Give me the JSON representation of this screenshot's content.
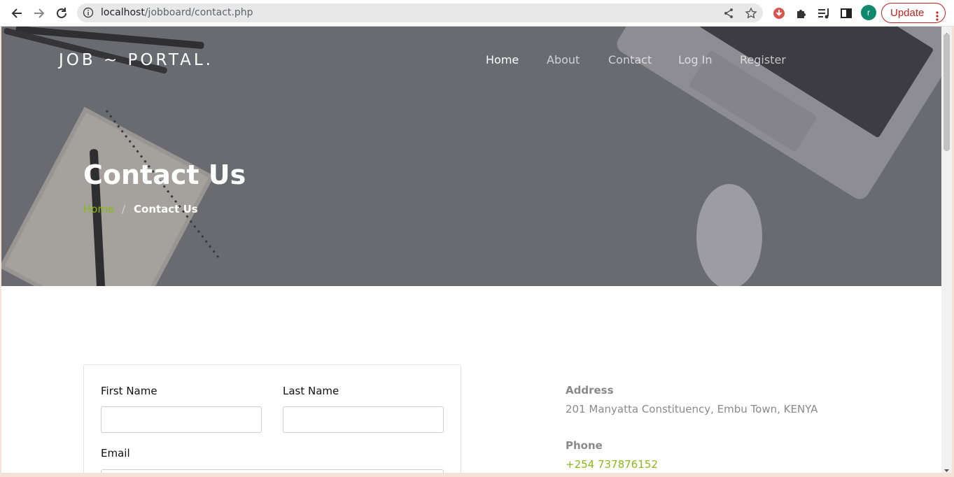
{
  "browser": {
    "url_host": "localhost",
    "url_path": "/jobboard/contact.php",
    "avatar_letter": "r",
    "update_label": "Update"
  },
  "site": {
    "logo": "JOB ~ PORTAL.",
    "nav": [
      {
        "label": "Home"
      },
      {
        "label": "About"
      },
      {
        "label": "Contact"
      },
      {
        "label": "Log In"
      },
      {
        "label": "Register"
      }
    ]
  },
  "hero": {
    "title": "Contact Us",
    "breadcrumb_home": "Home",
    "breadcrumb_sep": "/",
    "breadcrumb_current": "Contact Us"
  },
  "form": {
    "first_name_label": "First Name",
    "last_name_label": "Last Name",
    "email_label": "Email",
    "first_name_value": "",
    "last_name_value": "",
    "email_value": ""
  },
  "contact_info": {
    "address_heading": "Address",
    "address_text": "201 Manyatta Constituency, Embu Town, KENYA",
    "phone_heading": "Phone",
    "phone_text": "+254 737876152"
  },
  "colors": {
    "accent_green": "#89ba16",
    "update_red": "#c5221f"
  }
}
